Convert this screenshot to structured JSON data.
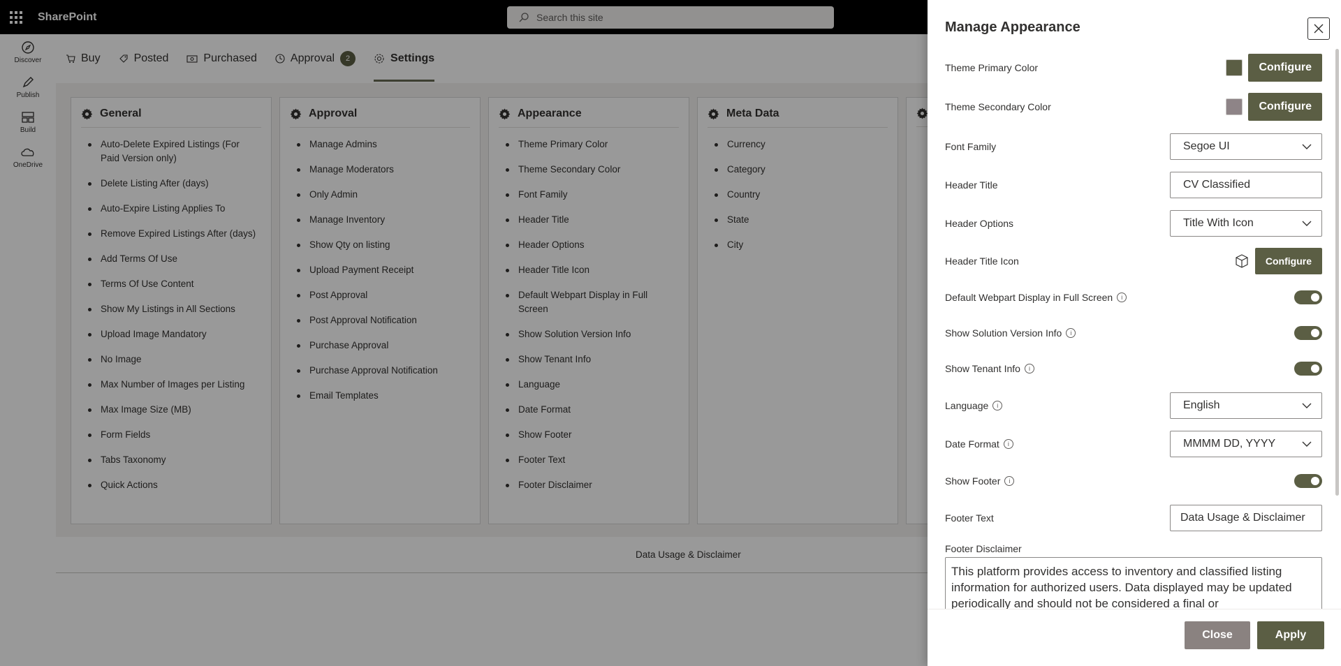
{
  "suitebar": {
    "brand": "SharePoint",
    "search_placeholder": "Search this site"
  },
  "appbar": {
    "items": [
      {
        "label": "Discover",
        "icon": "compass-icon"
      },
      {
        "label": "Publish",
        "icon": "pen-icon"
      },
      {
        "label": "Build",
        "icon": "grid-icon"
      },
      {
        "label": "OneDrive",
        "icon": "cloud-icon"
      }
    ]
  },
  "tabs": [
    {
      "label": "Buy",
      "icon": "cart-icon"
    },
    {
      "label": "Posted",
      "icon": "tag-icon"
    },
    {
      "label": "Purchased",
      "icon": "money-icon"
    },
    {
      "label": "Approval",
      "icon": "clock-icon",
      "badge": "2"
    },
    {
      "label": "Settings",
      "icon": "gear-icon",
      "active": true
    }
  ],
  "cards": [
    {
      "title": "General",
      "items": [
        "Auto-Delete Expired Listings (For Paid Version only)",
        "Delete Listing After (days)",
        "Auto-Expire Listing Applies To",
        "Remove Expired Listings After (days)",
        "Add Terms Of Use",
        "Terms Of Use Content",
        "Show My Listings in All Sections",
        "Upload Image Mandatory",
        "No Image",
        "Max Number of Images per Listing",
        "Max Image Size (MB)",
        "Form Fields",
        "Tabs Taxonomy",
        "Quick Actions"
      ]
    },
    {
      "title": "Approval",
      "items": [
        "Manage Admins",
        "Manage Moderators",
        "Only Admin",
        "Manage Inventory",
        "Show Qty on listing",
        "Upload Payment Receipt",
        "Post Approval",
        "Post Approval Notification",
        "Purchase Approval",
        "Purchase Approval Notification",
        "Email Templates"
      ]
    },
    {
      "title": "Appearance",
      "items": [
        "Theme Primary Color",
        "Theme Secondary Color",
        "Font Family",
        "Header Title",
        "Header Options",
        "Header Title Icon",
        "Default Webpart Display in Full Screen",
        "Show Solution Version Info",
        "Show Tenant Info",
        "Language",
        "Date Format",
        "Show Footer",
        "Footer Text",
        "Footer Disclaimer"
      ]
    },
    {
      "title": "Meta Data",
      "items": [
        "Currency",
        "Category",
        "Country",
        "State",
        "City"
      ]
    }
  ],
  "page_footer": "Data Usage & Disclaimer",
  "panel": {
    "title": "Manage Appearance",
    "primary_color_label": "Theme Primary Color",
    "primary_color": "#5b5e44",
    "secondary_color_label": "Theme Secondary Color",
    "secondary_color": "#8e8487",
    "configure_label": "Configure",
    "font_family_label": "Font Family",
    "font_family_value": "Segoe UI",
    "header_title_label": "Header Title",
    "header_title_value": "CV Classified",
    "header_options_label": "Header Options",
    "header_options_value": "Title With Icon",
    "header_title_icon_label": "Header Title Icon",
    "header_title_icon": "cube-icon",
    "fullscreen_label": "Default Webpart Display in Full Screen",
    "fullscreen_on": true,
    "version_info_label": "Show Solution Version Info",
    "version_info_on": true,
    "tenant_info_label": "Show Tenant Info",
    "tenant_info_on": true,
    "language_label": "Language",
    "language_value": "English",
    "date_format_label": "Date Format",
    "date_format_value": "MMMM DD, YYYY",
    "show_footer_label": "Show Footer",
    "show_footer_on": true,
    "footer_text_label": "Footer Text",
    "footer_text_value": "Data Usage & Disclaimer",
    "footer_disclaimer_label": "Footer Disclaimer",
    "footer_disclaimer_value": "This platform provides access to inventory and classified listing information for authorized users. Data displayed may be updated periodically and should not be considered a final or",
    "close_label": "Close",
    "apply_label": "Apply"
  },
  "colors": {
    "accent": "#5b5e44",
    "close_button": "#8a8280"
  }
}
